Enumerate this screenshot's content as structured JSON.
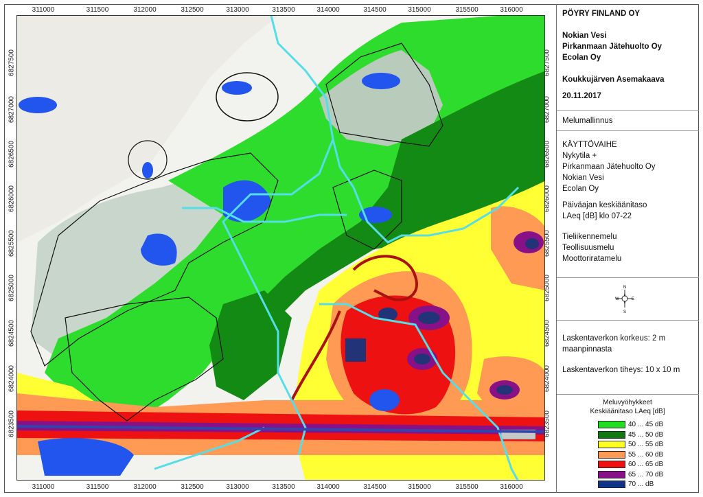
{
  "map": {
    "x_ticks_top": [
      "311000",
      "311500",
      "312000",
      "312500",
      "313000",
      "313500",
      "314000",
      "314500",
      "315000",
      "315500",
      "316000"
    ],
    "x_ticks_bottom": [
      "311000",
      "311500",
      "312000",
      "312500",
      "313000",
      "313500",
      "314000",
      "314500",
      "315000",
      "315500",
      "316000"
    ],
    "y_ticks_left": [
      "6827500",
      "6827000",
      "6826500",
      "6826000",
      "6825500",
      "6825000",
      "6824500",
      "6824000",
      "6823500"
    ],
    "y_ticks_right": [
      "6827500",
      "6827000",
      "6826500",
      "6826000",
      "6825500",
      "6825000",
      "6824500",
      "6824000",
      "6823500"
    ]
  },
  "panel": {
    "company": "PÖYRY FINLAND OY",
    "clients": [
      "Nokian Vesi",
      "Pirkanmaan Jätehuolto Oy",
      "Ecolan Oy"
    ],
    "project": "Koukkujärven Asemakaava",
    "date": "20.11.2017",
    "model": "Melumallinnus",
    "phase_lines": [
      "KÄYTTÖVAIHE",
      "Nykytila +",
      "Pirkanmaan Jätehuolto Oy",
      "Nokian Vesi",
      "Ecolan Oy"
    ],
    "level_lines": [
      "Päiväajan keskiäänitaso",
      "LAeq [dB] klo 07-22"
    ],
    "noise_types": [
      "Tieliikennemelu",
      "Teollisuusmelu",
      "Moottoriratamelu"
    ],
    "compass": {
      "n": "N",
      "e": "E",
      "s": "S",
      "w": "W"
    },
    "grid_height_lines": [
      "Laskentaverkon korkeus: 2 m",
      "maanpinnasta"
    ],
    "grid_density": "Laskentaverkon tiheys: 10 x 10 m"
  },
  "legend": {
    "title": "Meluvyöhykkeet",
    "subtitle": "Keskiäänitaso LAeq [dB]",
    "items": [
      {
        "label": "40 ... 45 dB",
        "color": "#22dd22"
      },
      {
        "label": "45 ... 50 dB",
        "color": "#117711"
      },
      {
        "label": "50 ... 55 dB",
        "color": "#ffff22"
      },
      {
        "label": "55 ... 60 dB",
        "color": "#ff9955"
      },
      {
        "label": "60 ... 65 dB",
        "color": "#ee1111"
      },
      {
        "label": "65 ... 70 dB",
        "color": "#881188"
      },
      {
        "label": "70 ...   dB",
        "color": "#113388"
      }
    ]
  }
}
